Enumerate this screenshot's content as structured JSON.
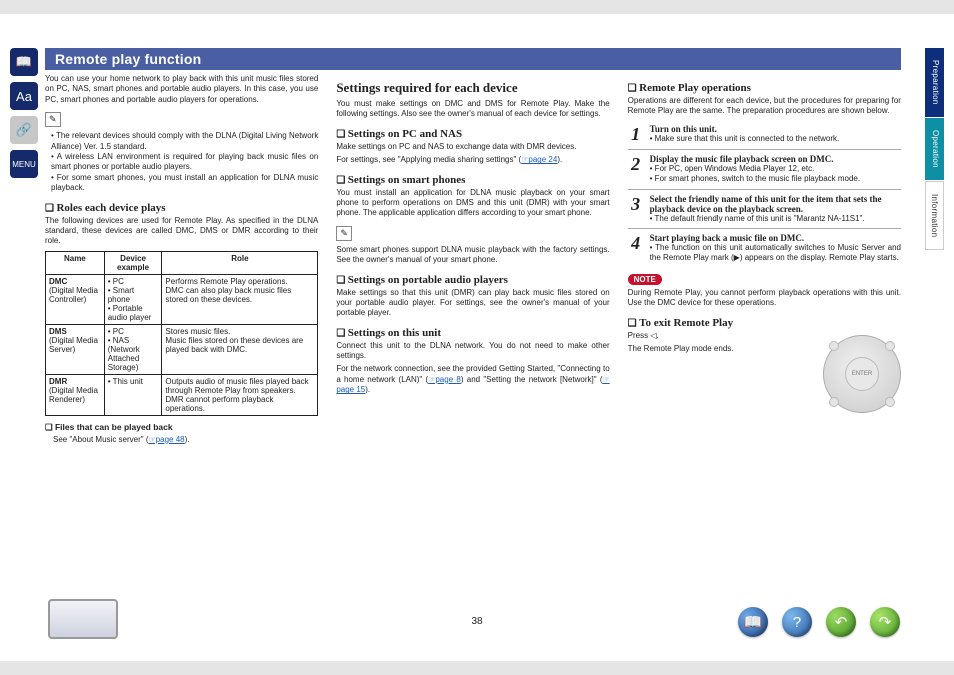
{
  "page_number": "38",
  "title": "Remote play function",
  "sidebar": {
    "prep": "Preparation",
    "op": "Operation",
    "info": "Information"
  },
  "rail": {
    "book": "📖",
    "aa": "Aa",
    "menu": "MENU"
  },
  "col1": {
    "intro": "You can use your home network to play back with this unit music files stored on PC, NAS, smart phones and portable audio players. In this case, you use PC, smart phones and portable audio players for operations.",
    "bullets": [
      "The relevant devices should comply with the DLNA (Digital Living Network Alliance) Ver. 1.5 standard.",
      "A wireless LAN environment is required for playing back music files on smart phones or portable audio players.",
      "For some smart phones, you must install an application for DLNA music playback."
    ],
    "roles_h": "Roles each device plays",
    "roles_text": "The following devices are used for Remote Play. As specified in the DLNA standard, these devices are called DMC, DMS or DMR according to their role.",
    "table": {
      "headers": [
        "Name",
        "Device example",
        "Role"
      ],
      "rows": [
        {
          "name": "DMC",
          "sub": "(Digital Media Controller)",
          "ex": "• PC\n• Smart phone\n• Portable audio player",
          "role": "Performs Remote Play operations.\nDMC can also play back music files stored on these devices."
        },
        {
          "name": "DMS",
          "sub": "(Digital Media Server)",
          "ex": "• PC\n• NAS\n  (Network Attached Storage)",
          "role": "Stores music files.\nMusic files stored on these devices are played back with DMC."
        },
        {
          "name": "DMR",
          "sub": "(Digital Media Renderer)",
          "ex": "• This unit",
          "role": "Outputs audio of music files played back through Remote Play from speakers. DMR cannot perform playback operations."
        }
      ]
    },
    "files_h": "Files that can be played back",
    "files_text_a": "See \"About Music server\" (",
    "files_link": "☞page 48",
    "files_text_b": ")."
  },
  "col2": {
    "h2": "Settings required for each device",
    "lead": "You must make settings on DMC and DMS for Remote Play. Make the following settings. Also see the owner's manual of each device for settings.",
    "pc_h": "Settings on PC and NAS",
    "pc_p1": "Make settings on PC and NAS to exchange data with DMR devices.",
    "pc_p2_a": "For settings, see \"Applying media sharing settings\" (",
    "pc_link": "☞page 24",
    "pc_p2_b": ").",
    "sp_h": "Settings on smart phones",
    "sp_p": "You must install an application for DLNA music playback on your smart phone to perform operations on DMS and this unit (DMR) with your smart phone. The applicable application differs according to your smart phone.",
    "sp_note": "Some smart phones support DLNA music playback with the factory settings. See the owner's manual of your smart phone.",
    "pa_h": "Settings on portable audio players",
    "pa_p": "Make settings so that this unit (DMR) can play back music files stored on your portable audio player. For settings, see the owner's manual of your portable player.",
    "su_h": "Settings on this unit",
    "su_p1": "Connect this unit to the DLNA network. You do not need to make other settings.",
    "su_p2_a": "For the network connection, see the provided Getting Started, \"Connecting to a home network (LAN)\" (",
    "su_link1": "☞page 8",
    "su_p2_b": ") and \"Setting the network [Network]\" (",
    "su_link2": "☞page 15",
    "su_p2_c": ")."
  },
  "col3": {
    "rp_h": "Remote Play operations",
    "rp_text": "Operations are different for each device, but the procedures for preparing for Remote Play are the same. The preparation procedures are shown below.",
    "steps": [
      {
        "n": "1",
        "b": "Turn on this unit.",
        "t": "Make sure that this unit is connected to the network."
      },
      {
        "n": "2",
        "b": "Display the music file playback screen on DMC.",
        "t": "For PC, open Windows Media Player 12, etc.|For smart phones, switch to the music file playback mode."
      },
      {
        "n": "3",
        "b": "Select the friendly name of this unit for the item that sets the playback device on the playback screen.",
        "t": "The default friendly name of this unit is \"Marantz NA-11S1\"."
      },
      {
        "n": "4",
        "b": "Start playing back a music file on DMC.",
        "t": "The function on this unit automatically switches to Music Server and the Remote Play mark (▶) appears on the display. Remote Play starts."
      }
    ],
    "note_label": "NOTE",
    "note_text": "During Remote Play, you cannot perform playback operations with this unit. Use the DMC device for these operations.",
    "exit_h": "To exit Remote Play",
    "exit_p1": "Press ◁.",
    "exit_p2": "The Remote Play mode ends."
  }
}
